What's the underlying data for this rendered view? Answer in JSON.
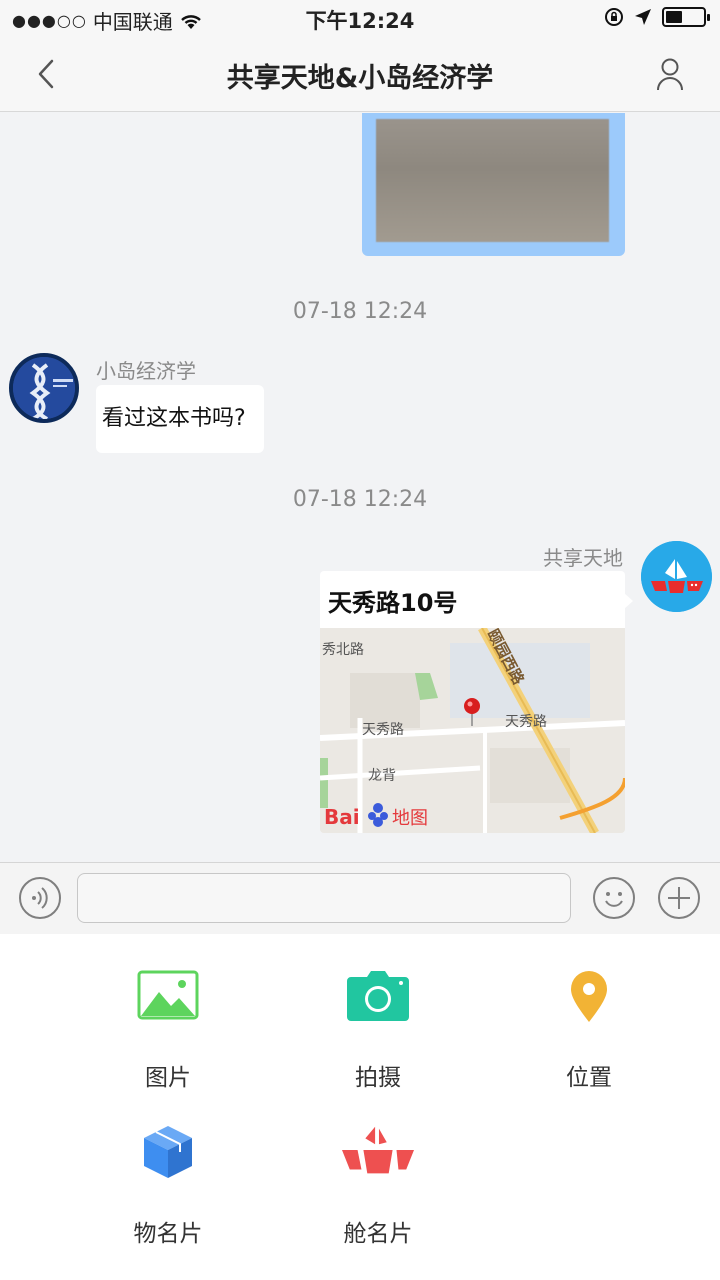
{
  "status_bar": {
    "carrier": "中国联通",
    "time": "下午12:24"
  },
  "nav": {
    "title": "共享天地&小岛经济学"
  },
  "messages": {
    "timestamp_1": "07-18 12:24",
    "left_sender": "小岛经济学",
    "left_text": "看过这本书吗?",
    "timestamp_2": "07-18 12:24",
    "right_sender": "共享天地",
    "location_title": "天秀路10号",
    "map_labels": {
      "road_1": "秀北路",
      "road_2": "天秀路",
      "road_3": "天秀路",
      "road_4": "颐园西路",
      "road_5": "龙背",
      "logo_bai": "Bai",
      "logo_map": "地图"
    }
  },
  "input": {
    "value": ""
  },
  "panel": {
    "items": [
      {
        "label": "图片",
        "icon": "image-icon",
        "color": "#5dd45d"
      },
      {
        "label": "拍摄",
        "icon": "camera-icon",
        "color": "#21c6a0"
      },
      {
        "label": "位置",
        "icon": "location-pin-icon",
        "color": "#f2b335"
      },
      {
        "label": "物名片",
        "icon": "box-icon",
        "color": "#3e8ef0"
      },
      {
        "label": "舱名片",
        "icon": "ship-icon",
        "color": "#ee5050"
      }
    ]
  },
  "colors": {
    "background": "#f2f3f5",
    "image_bubble": "#9ccafb",
    "right_avatar": "#28a9e8"
  }
}
